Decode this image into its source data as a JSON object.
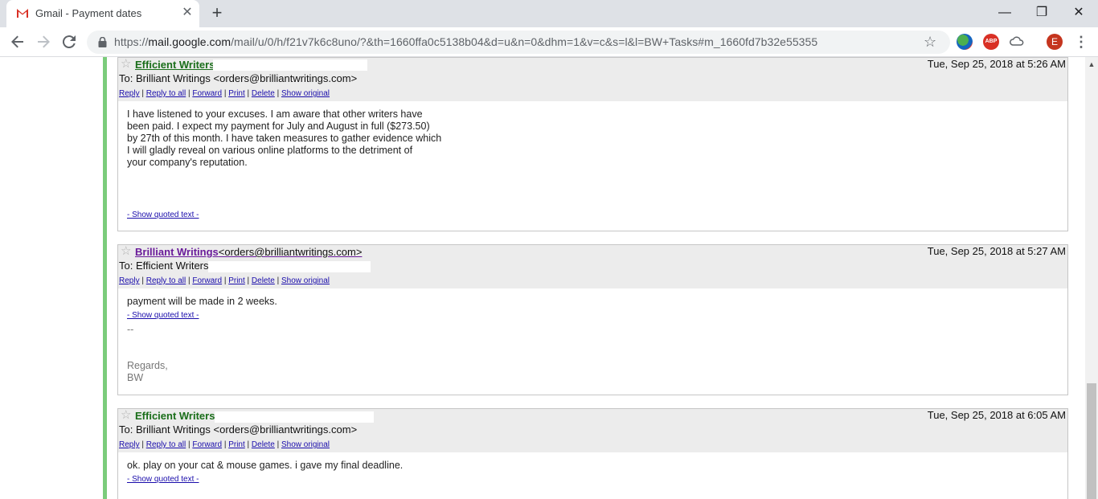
{
  "browser": {
    "tab_title": "Gmail - Payment dates",
    "tab_close": "✕",
    "new_tab": "+",
    "url_prefix": "https://",
    "url_host": "mail.google.com",
    "url_path": "/mail/u/0/h/f21v7k6c8uno/?&th=1660ffa0c5138b04&d=u&n=0&dhm=1&v=c&s=l&l=BW+Tasks#m_1660fd7b32e55355",
    "abp_label": "ABP",
    "avatar_letter": "E",
    "minimize": "—",
    "maximize": "❐",
    "close": "✕"
  },
  "actions": {
    "reply": "Reply",
    "reply_all": "Reply to all",
    "forward": "Forward",
    "print": "Print",
    "delete": "Delete",
    "show_original": "Show original",
    "show_quoted": "- Show quoted text -"
  },
  "messages": [
    {
      "sender": "Efficient Writers",
      "date": "Tue, Sep 25, 2018 at 5:26 AM",
      "to": "To: Brilliant Writings <orders@brilliantwritings.com>",
      "body": [
        "I have listened to your excuses. I am aware that other writers have",
        "been paid. I expect my payment for July and August in full ($273.50)",
        "by 27th of this month. I have taken measures to gather evidence which",
        "I will gladly reveal on various online platforms to the detriment of",
        "your company's reputation."
      ]
    },
    {
      "sender": "Brilliant Writings",
      "sender_email": "<orders@brilliantwritings.com>",
      "date": "Tue, Sep 25, 2018 at 5:27 AM",
      "to": "To: Efficient Writers",
      "body": [
        "payment will be made in 2 weeks."
      ],
      "sig_dash": "--",
      "sig_lines": [
        "Regards,",
        "BW"
      ]
    },
    {
      "sender": "Efficient Writers",
      "date": "Tue, Sep 25, 2018 at 6:05 AM",
      "to": "To: Brilliant Writings <orders@brilliantwritings.com>",
      "body": [
        "ok. play on your cat & mouse games. i gave my final deadline."
      ]
    }
  ]
}
